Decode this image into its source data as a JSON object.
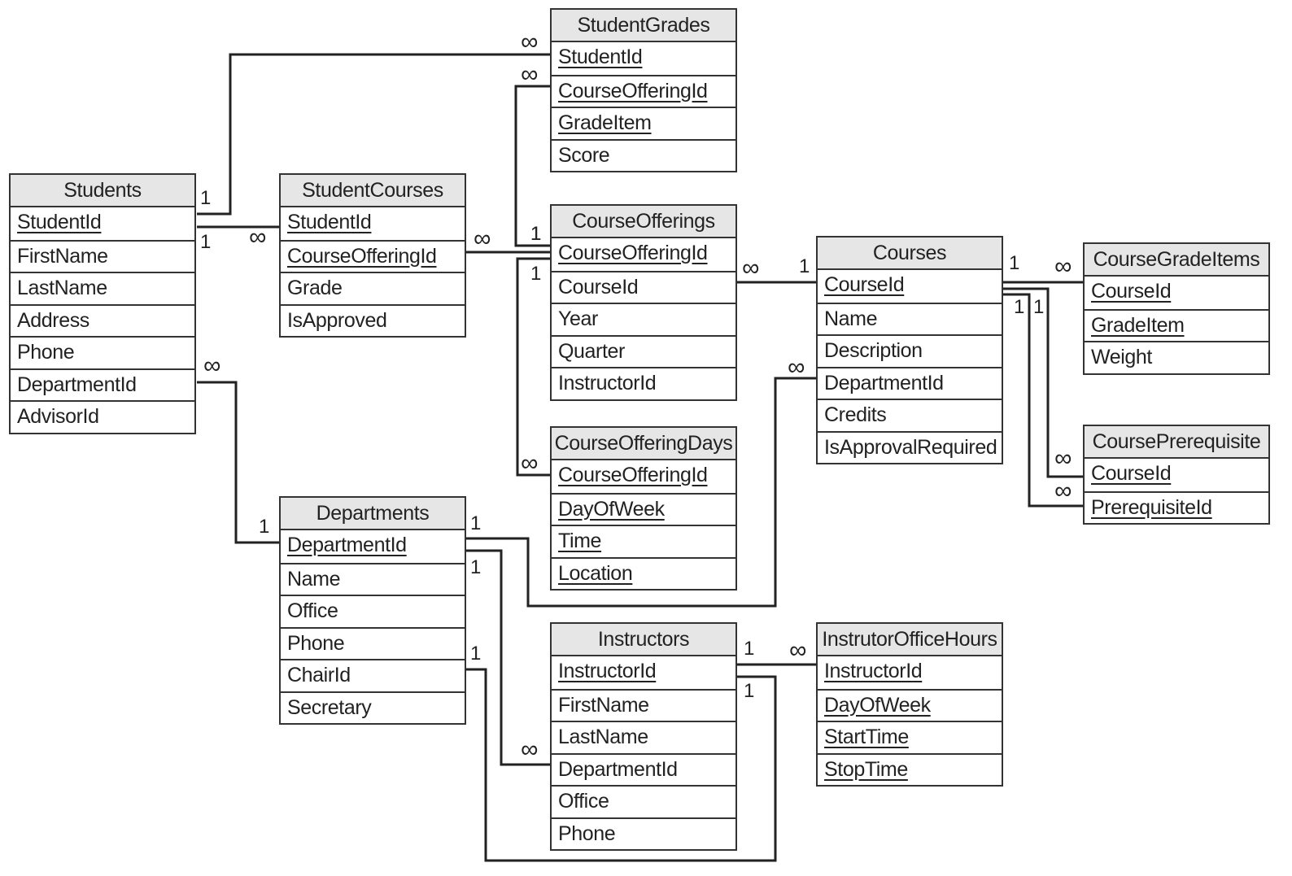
{
  "tables": [
    {
      "name": "StudentGrades",
      "fields": [
        {
          "name": "StudentId",
          "key": true
        },
        {
          "name": "CourseOfferingId",
          "key": true
        },
        {
          "name": "GradeItem",
          "key": true
        },
        {
          "name": "Score",
          "key": false
        }
      ]
    },
    {
      "name": "Students",
      "fields": [
        {
          "name": "StudentId",
          "key": true
        },
        {
          "name": "FirstName",
          "key": false
        },
        {
          "name": "LastName",
          "key": false
        },
        {
          "name": "Address",
          "key": false
        },
        {
          "name": "Phone",
          "key": false
        },
        {
          "name": "DepartmentId",
          "key": false
        },
        {
          "name": "AdvisorId",
          "key": false
        }
      ]
    },
    {
      "name": "StudentCourses",
      "fields": [
        {
          "name": "StudentId",
          "key": true
        },
        {
          "name": "CourseOfferingId",
          "key": true
        },
        {
          "name": "Grade",
          "key": false
        },
        {
          "name": "IsApproved",
          "key": false
        }
      ]
    },
    {
      "name": "CourseOfferings",
      "fields": [
        {
          "name": "CourseOfferingId",
          "key": true
        },
        {
          "name": "CourseId",
          "key": false
        },
        {
          "name": "Year",
          "key": false
        },
        {
          "name": "Quarter",
          "key": false
        },
        {
          "name": "InstructorId",
          "key": false
        }
      ]
    },
    {
      "name": "Courses",
      "fields": [
        {
          "name": "CourseId",
          "key": true
        },
        {
          "name": "Name",
          "key": false
        },
        {
          "name": "Description",
          "key": false
        },
        {
          "name": "DepartmentId",
          "key": false
        },
        {
          "name": "Credits",
          "key": false
        },
        {
          "name": "IsApprovalRequired",
          "key": false
        }
      ]
    },
    {
      "name": "CourseGradeItems",
      "fields": [
        {
          "name": "CourseId",
          "key": true
        },
        {
          "name": "GradeItem",
          "key": true
        },
        {
          "name": "Weight",
          "key": false
        }
      ]
    },
    {
      "name": "CoursePrerequisite",
      "fields": [
        {
          "name": "CourseId",
          "key": true
        },
        {
          "name": "PrerequisiteId",
          "key": true
        }
      ]
    },
    {
      "name": "CourseOfferingDays",
      "fields": [
        {
          "name": "CourseOfferingId",
          "key": true
        },
        {
          "name": "DayOfWeek",
          "key": true
        },
        {
          "name": "Time",
          "key": true
        },
        {
          "name": "Location",
          "key": true
        }
      ]
    },
    {
      "name": "Departments",
      "fields": [
        {
          "name": "DepartmentId",
          "key": true
        },
        {
          "name": "Name",
          "key": false
        },
        {
          "name": "Office",
          "key": false
        },
        {
          "name": "Phone",
          "key": false
        },
        {
          "name": "ChairId",
          "key": false
        },
        {
          "name": "Secretary",
          "key": false
        }
      ]
    },
    {
      "name": "Instructors",
      "fields": [
        {
          "name": "InstructorId",
          "key": true
        },
        {
          "name": "FirstName",
          "key": false
        },
        {
          "name": "LastName",
          "key": false
        },
        {
          "name": "DepartmentId",
          "key": false
        },
        {
          "name": "Office",
          "key": false
        },
        {
          "name": "Phone",
          "key": false
        }
      ]
    },
    {
      "name": "InstrutorOfficeHours",
      "fields": [
        {
          "name": "InstructorId",
          "key": true
        },
        {
          "name": "DayOfWeek",
          "key": true
        },
        {
          "name": "StartTime",
          "key": true
        },
        {
          "name": "StopTime",
          "key": true
        }
      ]
    }
  ],
  "relationships": [
    {
      "from": "Students.StudentId",
      "to": "StudentGrades.StudentId",
      "from_card": "1",
      "to_card": "∞"
    },
    {
      "from": "Students.StudentId",
      "to": "StudentCourses.StudentId",
      "from_card": "1",
      "to_card": "∞"
    },
    {
      "from": "CourseOfferings.CourseOfferingId",
      "to": "StudentCourses.CourseOfferingId",
      "from_card": "1",
      "to_card": "∞"
    },
    {
      "from": "CourseOfferings.CourseOfferingId",
      "to": "StudentGrades.CourseOfferingId",
      "from_card": "1",
      "to_card": "∞"
    },
    {
      "from": "CourseOfferings.CourseOfferingId",
      "to": "CourseOfferingDays.CourseOfferingId",
      "from_card": "1",
      "to_card": "∞"
    },
    {
      "from": "Courses.CourseId",
      "to": "CourseOfferings.CourseId",
      "from_card": "1",
      "to_card": "∞"
    },
    {
      "from": "Courses.CourseId",
      "to": "CourseGradeItems.CourseId",
      "from_card": "1",
      "to_card": "∞"
    },
    {
      "from": "Courses.CourseId",
      "to": "CoursePrerequisite.CourseId",
      "from_card": "1",
      "to_card": "∞"
    },
    {
      "from": "Courses.CourseId",
      "to": "CoursePrerequisite.PrerequisiteId",
      "from_card": "1",
      "to_card": "∞"
    },
    {
      "from": "Departments.DepartmentId",
      "to": "Students.DepartmentId",
      "from_card": "1",
      "to_card": "∞"
    },
    {
      "from": "Departments.DepartmentId",
      "to": "Courses.DepartmentId",
      "from_card": "1",
      "to_card": "∞"
    },
    {
      "from": "Departments.DepartmentId",
      "to": "Instructors.DepartmentId",
      "from_card": "1",
      "to_card": "∞"
    },
    {
      "from": "Instructors.InstructorId",
      "to": "Departments.ChairId",
      "from_card": "1",
      "to_card": "1"
    },
    {
      "from": "Instructors.InstructorId",
      "to": "InstrutorOfficeHours.InstructorId",
      "from_card": "1",
      "to_card": "∞"
    }
  ]
}
